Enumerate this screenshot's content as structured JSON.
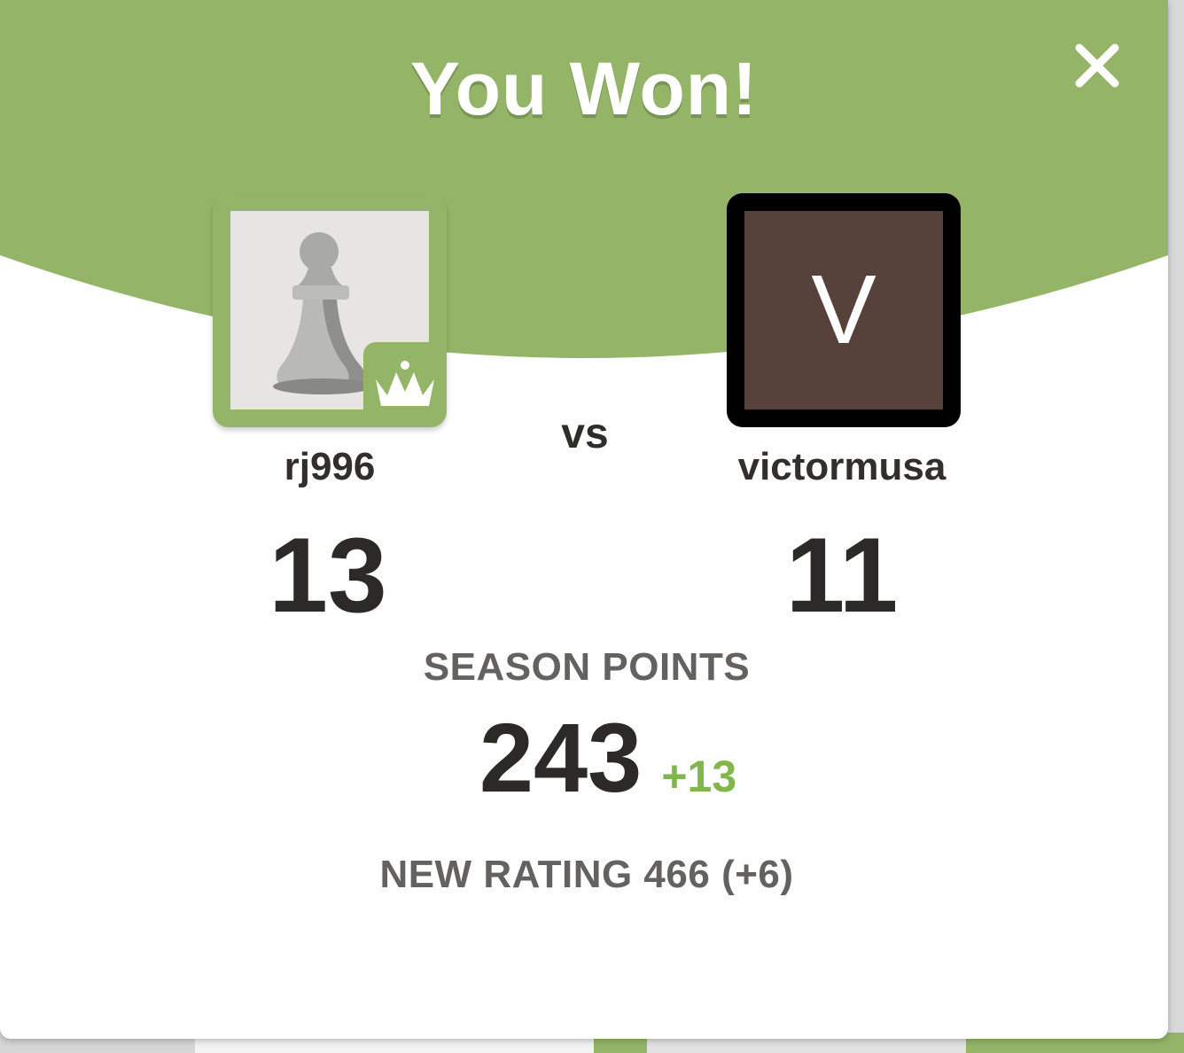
{
  "title": "You Won!",
  "close_icon": "close-icon",
  "colors": {
    "header_green": "#94b568",
    "delta_green": "#81b64c",
    "opponent_avatar_bg": "#56423a"
  },
  "players": {
    "left": {
      "username": "rj996",
      "score": "13",
      "avatar_icon": "pawn-icon",
      "badge_icon": "crown-icon"
    },
    "right": {
      "username": "victormusa",
      "score": "11",
      "avatar_letter": "V"
    }
  },
  "vs_label": "vs",
  "season": {
    "label": "SEASON POINTS",
    "value": "243",
    "delta": "+13"
  },
  "new_rating": "NEW RATING 466 (+6)"
}
